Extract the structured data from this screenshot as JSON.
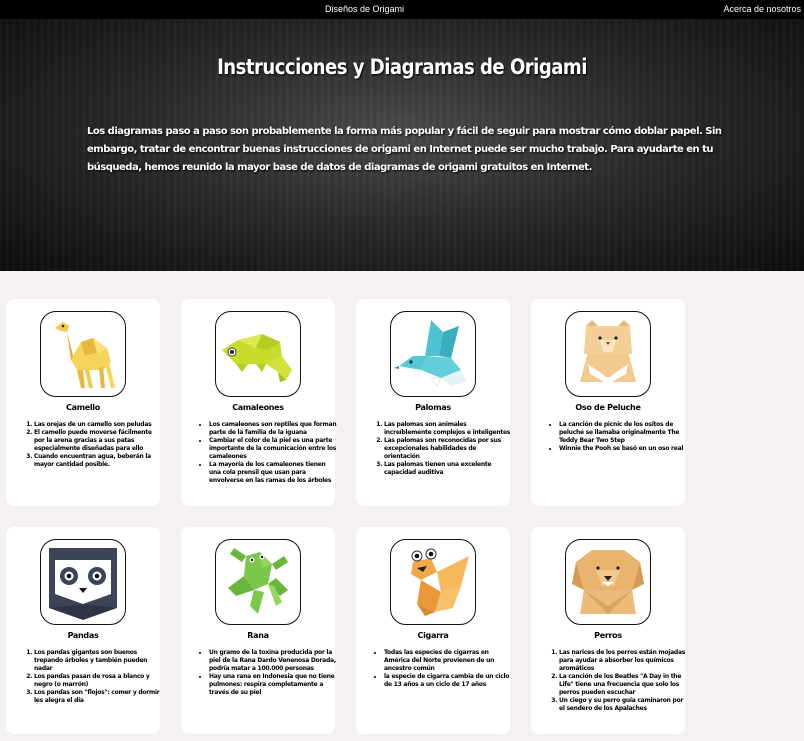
{
  "nav": {
    "designs": "Diseños de Origami",
    "about": "Acerca de nosotros"
  },
  "hero": {
    "title": "Instrucciones y Diagramas de Origami",
    "text": "Los diagramas paso a paso son probablemente la forma más popular y fácil de seguir para mostrar cómo doblar papel. Sin embargo, tratar de encontrar buenas instrucciones de origami en Internet puede ser mucho trabajo. Para ayudarte en tu búsqueda, hemos reunido la mayor base de datos de diagramas de origami gratuitos en Internet."
  },
  "cards": [
    {
      "title": "Camello",
      "image": "camel-origami",
      "list": "ordered",
      "items": [
        "Las orejas de un camello son peludas",
        "El camello puede moverse fácilmente por la arena gracias a sus patas especialmente diseñadas para ello",
        "Cuando encuentran agua, beberán la mayor cantidad posible."
      ]
    },
    {
      "title": "Camaleones",
      "image": "chameleon-origami",
      "list": "unordered",
      "items": [
        "Los camaleones son reptiles que forman parte de la familia de la iguana",
        "Cambiar el color de la piel es una parte importante de la comunicación entre los camaleones",
        "La mayoría de los camaleones tienen una cola prensil que usan para envolverse en las ramas de los árboles"
      ]
    },
    {
      "title": "Palomas",
      "image": "dove-origami",
      "list": "ordered",
      "items": [
        "Las palomas son animales increíblemente complejos e inteligentes",
        "Las palomas son reconocidas por sus excepcionales habilidades de orientación",
        "Las palomas tienen una excelente capacidad auditiva"
      ]
    },
    {
      "title": "Oso de Peluche",
      "image": "teddy-bear-origami",
      "list": "unordered",
      "items": [
        "La canción de picnic de los ositos de peluche se llamaba originalmente The Teddy Bear Two Step",
        "Winnie the Pooh se basó en un oso real"
      ]
    },
    {
      "title": "Pandas",
      "image": "panda-origami",
      "list": "ordered",
      "items": [
        "Los pandas gigantes son buenos trepando árboles y también pueden nadar",
        "Los pandas pasan de rosa a blanco y negro (o marrón)",
        "Los pandas son \"flojos\": comer y dormir les alegra el día"
      ]
    },
    {
      "title": "Rana",
      "image": "frog-origami",
      "list": "unordered",
      "items": [
        "Un gramo de la toxina producida por la piel de la Rana Dardo Venenosa Dorada, podría matar a 100.000 personas",
        "Hay una rana en Indonesia que no tiene pulmones: respira completamente a través de su piel"
      ]
    },
    {
      "title": "Cigarra",
      "image": "cicada-origami",
      "list": "unordered",
      "items": [
        "Todas las especies de cigarras en América del Norte provienen de un ancestro común",
        "la especie de cigarra cambia de un ciclo de 13 años a un ciclo de 17 años"
      ]
    },
    {
      "title": "Perros",
      "image": "dog-origami",
      "list": "ordered",
      "items": [
        "Las narices de los perros están mojadas para ayudar a absorber los químicos aromáticos",
        "La canción de los Beatles \"A Day in the Life\" tiene una frecuencia que solo los perros pueden escuchar",
        "Un ciego y su perro guía caminaron por el sendero de los Apalaches"
      ]
    }
  ]
}
